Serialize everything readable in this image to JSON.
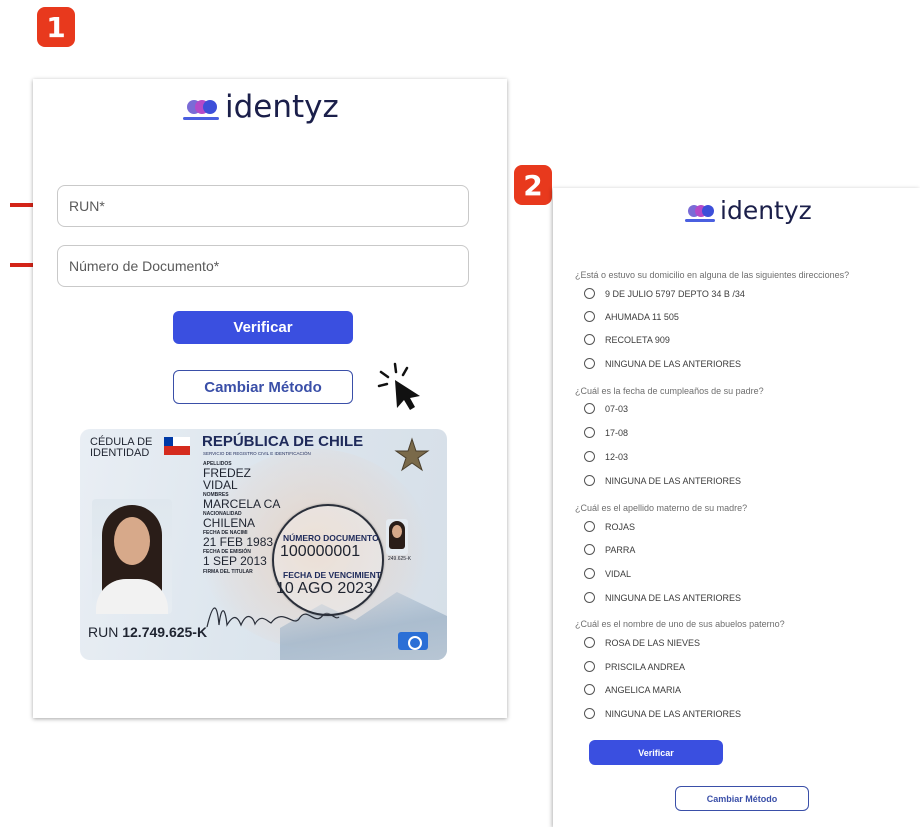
{
  "badges": {
    "step1": "1",
    "step2": "2"
  },
  "brand": {
    "name": "identyz",
    "colors": {
      "dark": "#1b1f4a",
      "accent": "#3a4fe0"
    }
  },
  "step1": {
    "run_placeholder": "RUN*",
    "document_placeholder": "Número de Documento*",
    "verify_label": "Verificar",
    "change_method_label": "Cambiar Método",
    "id_card": {
      "cedula": "CÉDULA DE IDENTIDAD",
      "republica": "REPÚBLICA DE CHILE",
      "registro": "SERVICIO DE REGISTRO CIVIL E IDENTIFICACIÓN",
      "apellidos_label": "APELLIDOS",
      "apellido1": "FREDEZ",
      "apellido2": "VIDAL",
      "nombres_label": "NOMBRES",
      "nombres": "MARCELA CA",
      "nacionalidad_label": "NACIONALIDAD",
      "nacionalidad": "CHILENA",
      "fecha_nac_label": "FECHA DE NACIMI",
      "fecha_nac": "21 FEB 1983",
      "fecha_emision_label": "FECHA DE EMISIÓN",
      "fecha_emision": "1 SEP 2013",
      "firma_label": "FIRMA DEL TITULAR",
      "numero_doc_label": "NÚMERO DOCUMENTO",
      "numero_doc": "100000001",
      "vencimiento_label": "FECHA DE VENCIMIENT",
      "vencimiento": "10 AGO 2023",
      "mini_run": "249.625-K",
      "run_prefix": "RUN",
      "run_value": "12.749.625-K"
    }
  },
  "step2": {
    "questions": [
      {
        "text": "¿Está o estuvo su domicilio en alguna de las siguientes direcciones?",
        "options": [
          "9 DE JULIO 5797 DEPTO 34 B /34",
          "AHUMADA 11 505",
          "RECOLETA 909",
          "NINGUNA DE LAS ANTERIORES"
        ]
      },
      {
        "text": "¿Cuál es la fecha de cumpleaños de su padre?",
        "options": [
          "07-03",
          "17-08",
          "12-03",
          "NINGUNA DE LAS ANTERIORES"
        ]
      },
      {
        "text": "¿Cuál es el apellido materno de su madre?",
        "options": [
          "ROJAS",
          "PARRA",
          "VIDAL",
          "NINGUNA DE LAS ANTERIORES"
        ]
      },
      {
        "text": "¿Cuál es el nombre de uno de sus abuelos paterno?",
        "options": [
          "ROSA DE LAS NIEVES",
          "PRISCILA ANDREA",
          "ANGELICA MARIA",
          "NINGUNA DE LAS ANTERIORES"
        ]
      }
    ],
    "verify_label": "Verificar",
    "change_method_label": "Cambiar Método"
  }
}
